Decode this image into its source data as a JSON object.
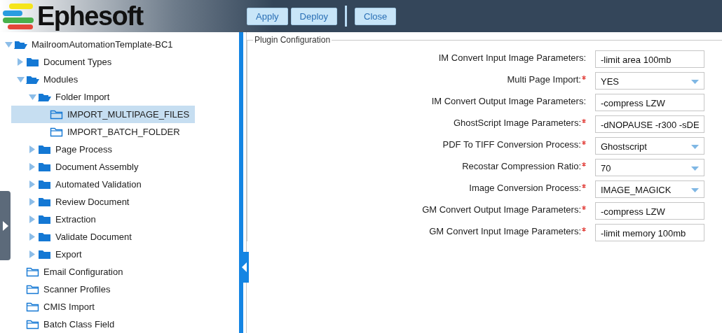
{
  "header": {
    "logo_text": "Ephesoft",
    "button_groups": [
      [
        "Apply",
        "Deploy"
      ],
      [
        "Close"
      ]
    ]
  },
  "tree": [
    {
      "label": "MailroomAutomationTemplate-BC1",
      "kind": "branch",
      "expanded": true,
      "selected": false,
      "children": [
        {
          "label": "Document Types",
          "kind": "branch",
          "expanded": false,
          "selected": false
        },
        {
          "label": "Modules",
          "kind": "branch",
          "expanded": true,
          "selected": false,
          "children": [
            {
              "label": "Folder Import",
              "kind": "branch",
              "expanded": true,
              "selected": false,
              "children": [
                {
                  "label": "IMPORT_MULTIPAGE_FILES",
                  "kind": "leaf",
                  "selected": true
                },
                {
                  "label": "IMPORT_BATCH_FOLDER",
                  "kind": "leaf",
                  "selected": false
                }
              ]
            },
            {
              "label": "Page Process",
              "kind": "branch",
              "expanded": false,
              "selected": false
            },
            {
              "label": "Document Assembly",
              "kind": "branch",
              "expanded": false,
              "selected": false
            },
            {
              "label": "Automated Validation",
              "kind": "branch",
              "expanded": false,
              "selected": false
            },
            {
              "label": "Review Document",
              "kind": "branch",
              "expanded": false,
              "selected": false
            },
            {
              "label": "Extraction",
              "kind": "branch",
              "expanded": false,
              "selected": false
            },
            {
              "label": "Validate Document",
              "kind": "branch",
              "expanded": false,
              "selected": false
            },
            {
              "label": "Export",
              "kind": "branch",
              "expanded": false,
              "selected": false
            }
          ]
        },
        {
          "label": "Email Configuration",
          "kind": "leaf",
          "selected": false
        },
        {
          "label": "Scanner Profiles",
          "kind": "leaf",
          "selected": false
        },
        {
          "label": "CMIS Import",
          "kind": "leaf",
          "selected": false
        },
        {
          "label": "Batch Class Field",
          "kind": "leaf",
          "selected": false
        }
      ]
    }
  ],
  "plugin_configuration": {
    "legend": "Plugin Configuration",
    "fields": [
      {
        "label": "IM Convert Input Image Parameters:",
        "required": false,
        "kind": "text",
        "value": "-limit area 100mb"
      },
      {
        "label": "Multi Page Import:",
        "required": true,
        "kind": "select",
        "value": "YES"
      },
      {
        "label": "IM Convert Output Image Parameters:",
        "required": false,
        "kind": "text",
        "value": "-compress LZW"
      },
      {
        "label": "GhostScript Image Parameters:",
        "required": true,
        "kind": "text",
        "value": "-dNOPAUSE -r300 -sDE"
      },
      {
        "label": "PDF To TIFF Conversion Process:",
        "required": true,
        "kind": "select",
        "value": "Ghostscript"
      },
      {
        "label": "Recostar Compression Ratio:",
        "required": true,
        "kind": "select",
        "value": "70"
      },
      {
        "label": "Image Conversion Process:",
        "required": true,
        "kind": "select",
        "value": "IMAGE_MAGICK"
      },
      {
        "label": "GM Convert Output Image Parameters:",
        "required": true,
        "kind": "text",
        "value": "-compress LZW"
      },
      {
        "label": "GM Convert Input Image Parameters:",
        "required": true,
        "kind": "text",
        "value": "-limit memory 100mb"
      }
    ]
  }
}
